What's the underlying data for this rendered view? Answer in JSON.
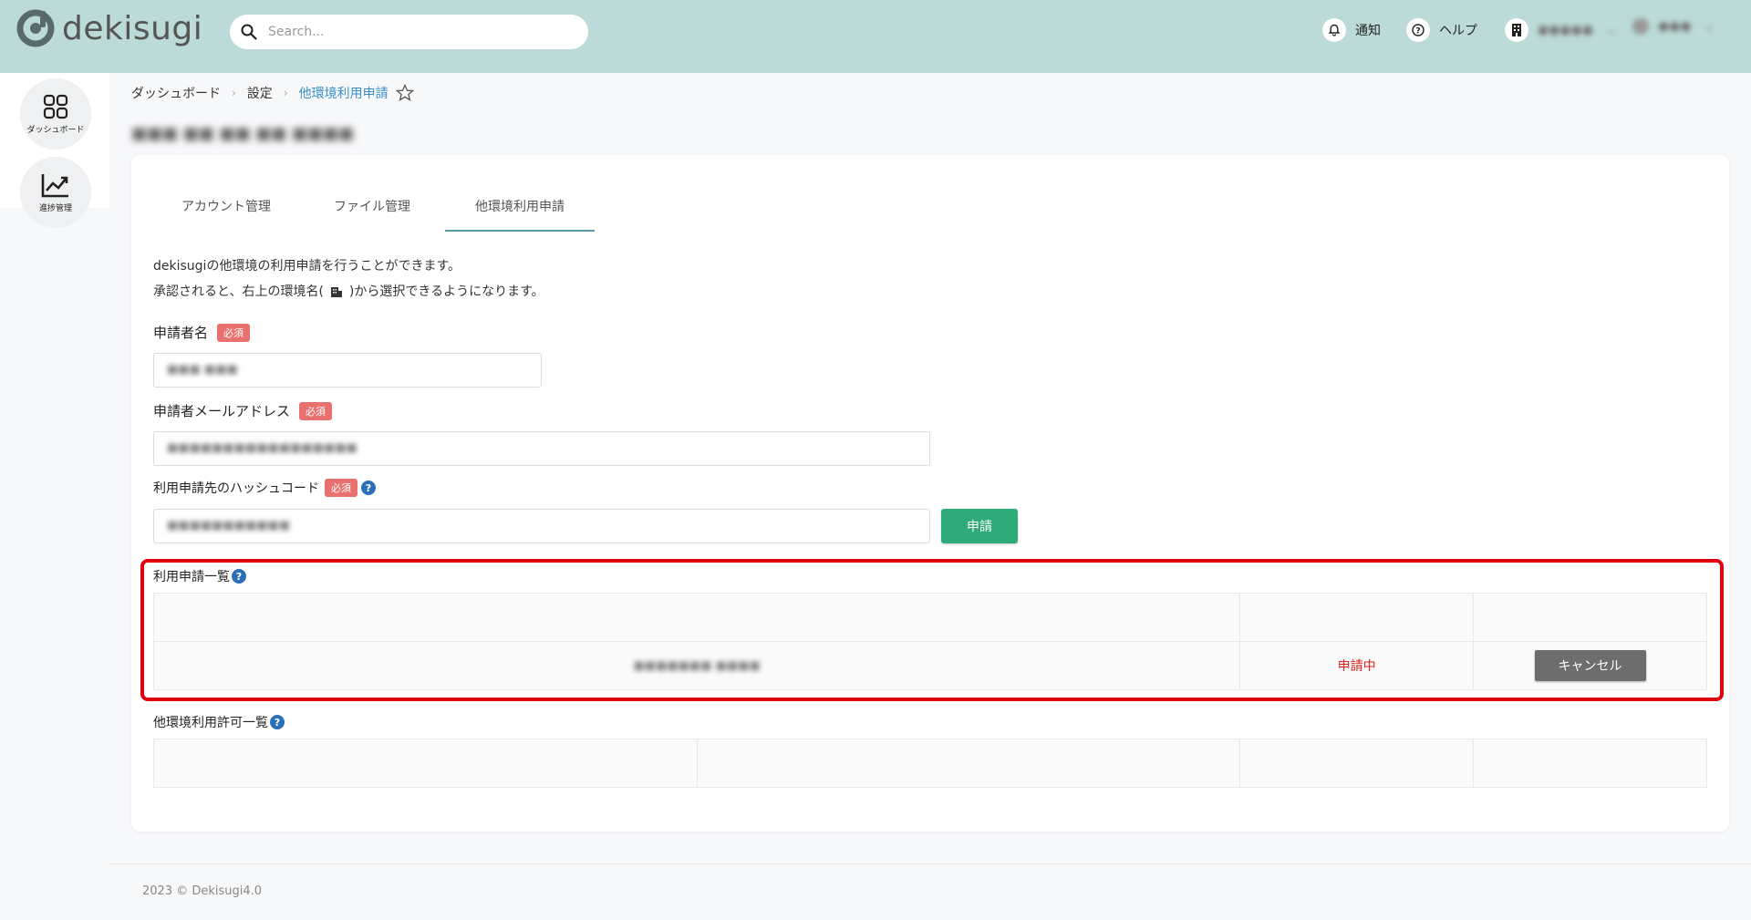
{
  "header": {
    "brand": "dekisugi",
    "search_placeholder": "Search...",
    "notification_label": "通知",
    "help_label": "ヘルプ",
    "environment_name": "●●●●●",
    "user_name": "●●●"
  },
  "sidebar": {
    "items": [
      {
        "label": "ダッシュボード",
        "icon": "grid-icon"
      },
      {
        "label": "進捗管理",
        "icon": "trend-chart-icon"
      }
    ]
  },
  "breadcrumb": {
    "items": [
      "ダッシュボード",
      "設定",
      "他環境利用申請"
    ]
  },
  "page_subtitle": "■■■ ■■ ■■ ■■ ■■■■",
  "tabs": [
    {
      "label": "アカウント管理",
      "active": false
    },
    {
      "label": "ファイル管理",
      "active": false
    },
    {
      "label": "他環境利用申請",
      "active": true
    }
  ],
  "description": {
    "line1": "dekisugiの他環境の利用申請を行うことができます。",
    "line2_pre": "承認されると、右上の環境名(",
    "line2_post": ")から選択できるようになります。"
  },
  "form": {
    "applicant_name_label": "申請者名",
    "applicant_name_value": "■■■ ■■■",
    "applicant_email_label": "申請者メールアドレス",
    "applicant_email_value": "■■■■■■■■■■■■■■■■■",
    "hash_code_label": "利用申請先のハッシュコード",
    "hash_code_value": "■■■■■■■■■■■",
    "required_badge": "必須",
    "submit_label": "申請"
  },
  "request_list": {
    "title": "利用申請一覧",
    "rows": [
      {
        "name": "■■■■■■■ ■■■■",
        "status": "申請中",
        "action": "キャンセル"
      }
    ]
  },
  "permission_list": {
    "title": "他環境利用許可一覧"
  },
  "footer": {
    "copyright": "2023 © Dekisugi4.0"
  },
  "colors": {
    "header_bg": "#bcdbd8",
    "accent_green": "#2eab78",
    "required_red": "#e8706e",
    "status_red": "#e02020",
    "highlight_red": "#e00010",
    "link_blue": "#3a8fc9"
  }
}
